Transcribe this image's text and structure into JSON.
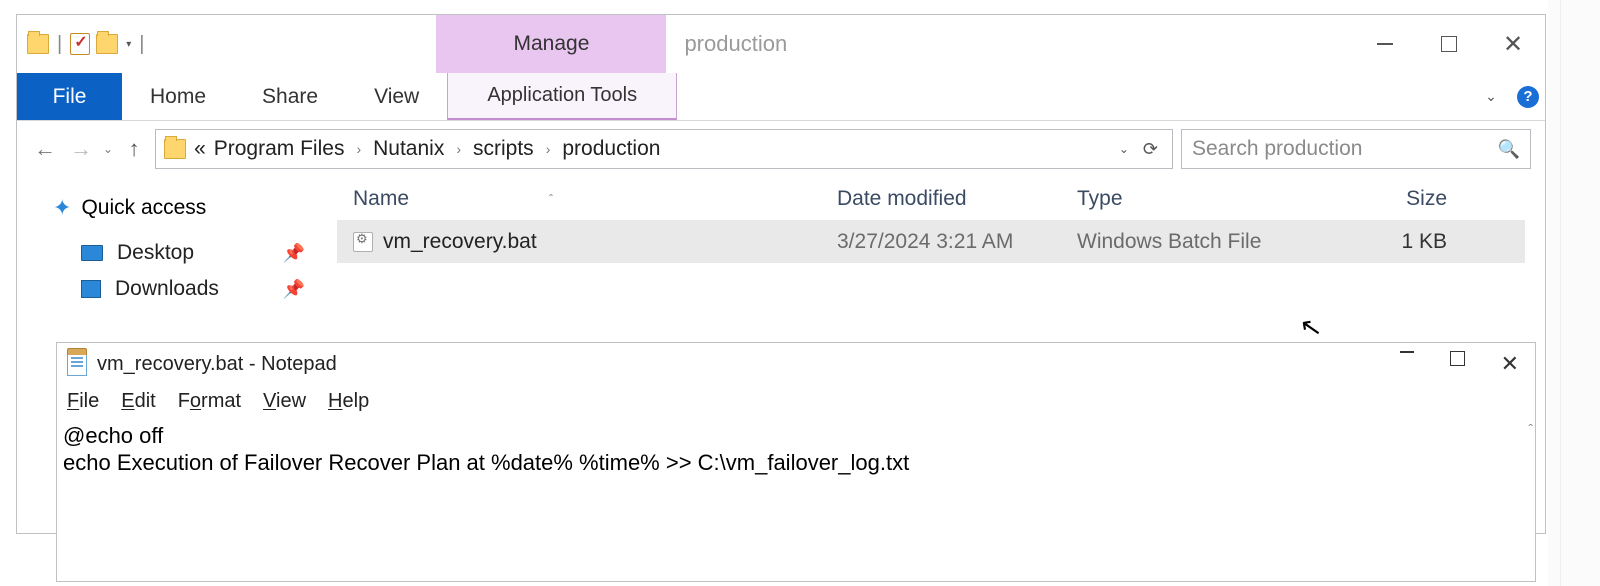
{
  "explorer": {
    "context_tab": "Manage",
    "context_subtab": "Application Tools",
    "window_title": "production",
    "ribbon": {
      "file": "File",
      "tabs": [
        "Home",
        "Share",
        "View"
      ]
    },
    "breadcrumb": {
      "overflow": "«",
      "segments": [
        "Program Files",
        "Nutanix",
        "scripts",
        "production"
      ]
    },
    "search_placeholder": "Search production",
    "navpane": {
      "quick_access": "Quick access",
      "items": [
        "Desktop",
        "Downloads"
      ]
    },
    "columns": {
      "name": "Name",
      "date": "Date modified",
      "type": "Type",
      "size": "Size"
    },
    "files": [
      {
        "name": "vm_recovery.bat",
        "date": "3/27/2024 3:21 AM",
        "type": "Windows Batch File",
        "size": "1 KB"
      }
    ]
  },
  "notepad": {
    "title": "vm_recovery.bat - Notepad",
    "menu": {
      "file": "File",
      "edit": "Edit",
      "format": "Format",
      "view": "View",
      "help": "Help"
    },
    "content": "@echo off\necho Execution of Failover Recover Plan at %date% %time% >> C:\\vm_failover_log.txt"
  }
}
